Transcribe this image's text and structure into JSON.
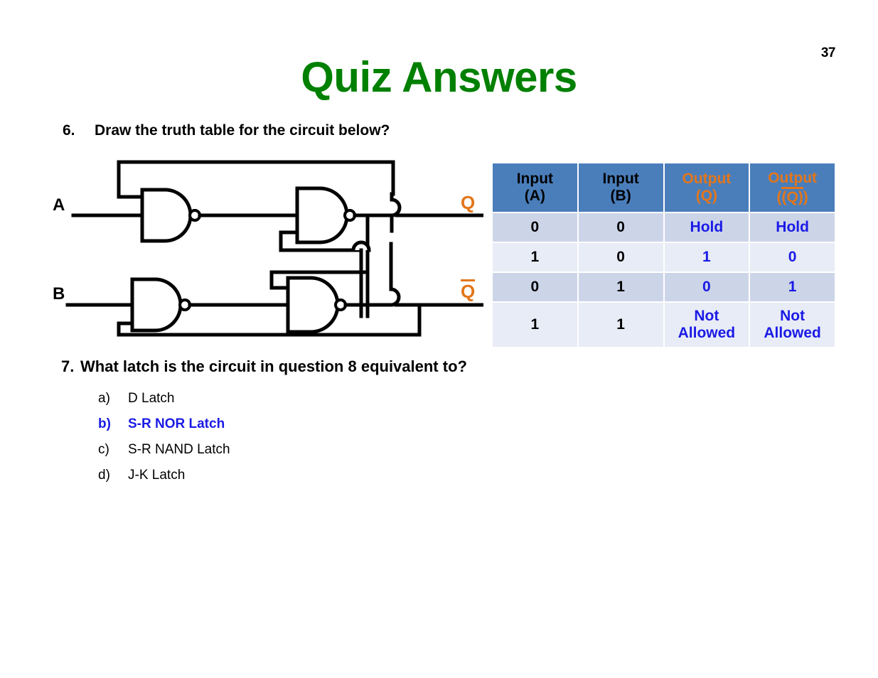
{
  "slide": {
    "title": "Quiz Answers",
    "page_number": "37",
    "title_color": "#008000",
    "accent_orange": "#e3761a",
    "accent_blue": "#1a1ae6",
    "table_header_blue": "#4a7ebb"
  },
  "question6": {
    "number": "6.",
    "text": "Draw the truth table for the circuit below?"
  },
  "question7": {
    "number": "7.",
    "text": "What latch is the circuit in question 8 equivalent to?",
    "options": [
      {
        "letter": "a)",
        "text": "D Latch",
        "correct": false
      },
      {
        "letter": "b)",
        "text": "S-R NOR Latch",
        "correct": true
      },
      {
        "letter": "c)",
        "text": "S-R NAND Latch",
        "correct": false
      },
      {
        "letter": "d)",
        "text": "J-K Latch",
        "correct": false
      }
    ]
  },
  "truth_table": {
    "headers": [
      {
        "line1": "Input",
        "line2": "(A)",
        "type": "input"
      },
      {
        "line1": "Input",
        "line2": "(B)",
        "type": "input"
      },
      {
        "line1": "Output",
        "line2": "(Q)",
        "type": "output"
      },
      {
        "line1": "Output",
        "line2": "(Q)",
        "type": "output-bar"
      }
    ],
    "rows": [
      {
        "a": "0",
        "b": "0",
        "q": "Hold",
        "qbar": "Hold"
      },
      {
        "a": "1",
        "b": "0",
        "q": "1",
        "qbar": "0"
      },
      {
        "a": "0",
        "b": "1",
        "q": "0",
        "qbar": "1"
      },
      {
        "a": "1",
        "b": "1",
        "q": "Not Allowed",
        "qbar": "Not Allowed"
      }
    ]
  },
  "circuit": {
    "input_a_label": "A",
    "input_b_label": "B",
    "output_q_label": "Q",
    "output_qbar_label": "Q",
    "gate_type": "NAND",
    "gate_count": 4
  }
}
